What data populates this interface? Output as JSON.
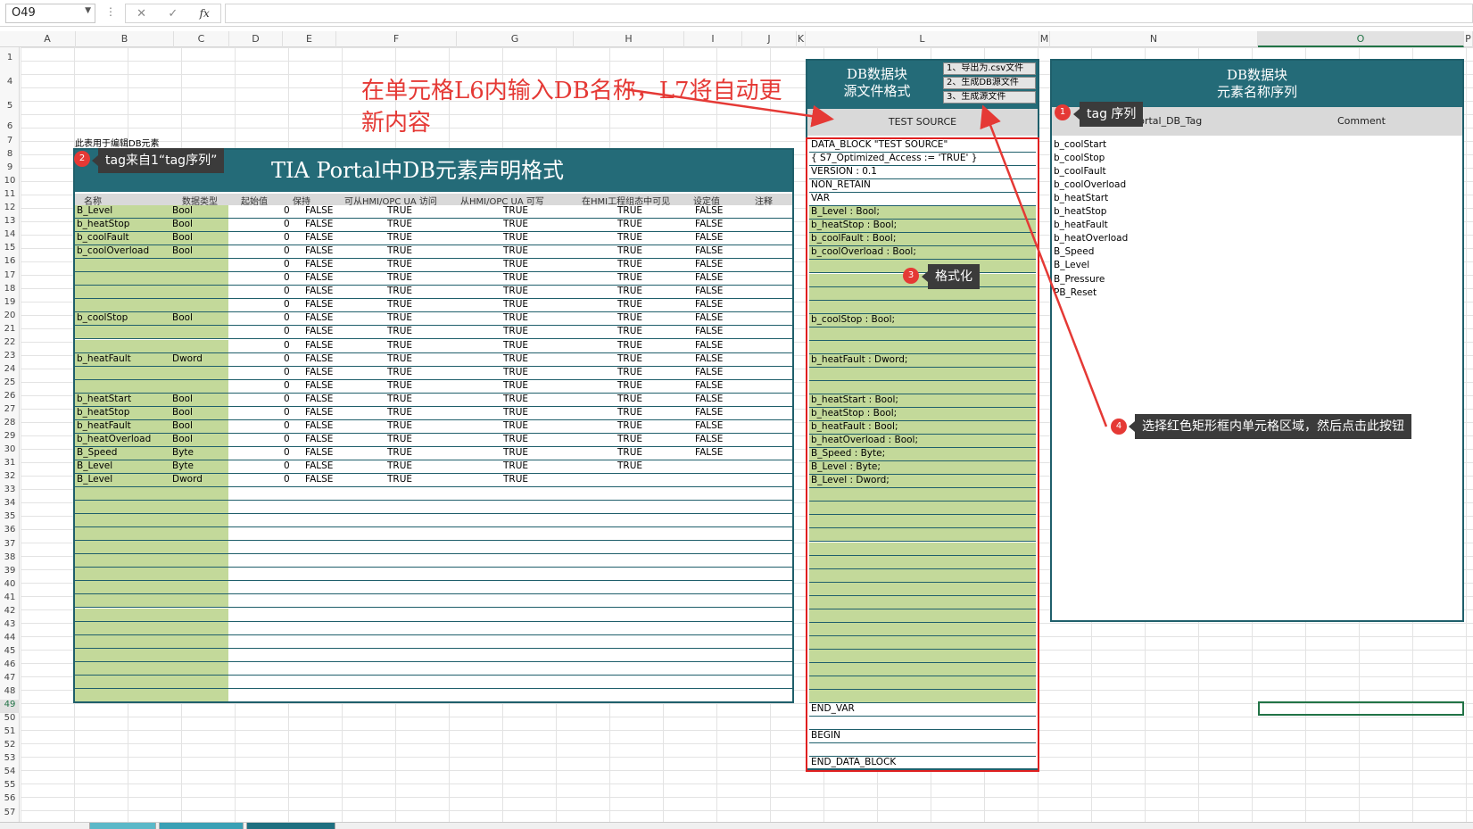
{
  "name_box": "O49",
  "formula_icons": {
    "cancel": "✕",
    "enter": "✓",
    "fx": "fx"
  },
  "columns": [
    "A",
    "B",
    "C",
    "D",
    "E",
    "F",
    "G",
    "H",
    "I",
    "J",
    "K",
    "L",
    "M",
    "N",
    "O",
    "P"
  ],
  "rows": [
    "1",
    "4",
    "5",
    "6",
    "7",
    "8",
    "9",
    "10",
    "11",
    "12",
    "13",
    "14",
    "15",
    "16",
    "17",
    "18",
    "19",
    "20",
    "21",
    "22",
    "23",
    "24",
    "25",
    "26",
    "27",
    "28",
    "29",
    "30",
    "31",
    "32",
    "33",
    "34",
    "35",
    "36",
    "37",
    "38",
    "39",
    "40",
    "41",
    "42",
    "43",
    "44",
    "45",
    "46",
    "47",
    "48",
    "49",
    "50",
    "51",
    "52",
    "53",
    "54",
    "55",
    "56",
    "57"
  ],
  "note_b7": "此表用于编辑DB元素",
  "left_table": {
    "title": "TIA Portal中DB元素声明格式",
    "headers": [
      "名称",
      "数据类型",
      "起始值",
      "保持",
      "可从HMI/OPC UA 访问",
      "从HMI/OPC UA 可写",
      "在HMI工程组态中可见",
      "设定值",
      "注释"
    ],
    "rows": [
      [
        "B_Level",
        "Bool",
        "0",
        "FALSE",
        "TRUE",
        "TRUE",
        "TRUE",
        "FALSE"
      ],
      [
        "b_heatStop",
        "Bool",
        "0",
        "FALSE",
        "TRUE",
        "TRUE",
        "TRUE",
        "FALSE"
      ],
      [
        "b_coolFault",
        "Bool",
        "0",
        "FALSE",
        "TRUE",
        "TRUE",
        "TRUE",
        "FALSE"
      ],
      [
        "b_coolOverload",
        "Bool",
        "0",
        "FALSE",
        "TRUE",
        "TRUE",
        "TRUE",
        "FALSE"
      ],
      [
        "",
        "",
        "0",
        "FALSE",
        "TRUE",
        "TRUE",
        "TRUE",
        "FALSE"
      ],
      [
        "",
        "",
        "0",
        "FALSE",
        "TRUE",
        "TRUE",
        "TRUE",
        "FALSE"
      ],
      [
        "",
        "",
        "0",
        "FALSE",
        "TRUE",
        "TRUE",
        "TRUE",
        "FALSE"
      ],
      [
        "",
        "",
        "0",
        "FALSE",
        "TRUE",
        "TRUE",
        "TRUE",
        "FALSE"
      ],
      [
        "b_coolStop",
        "Bool",
        "0",
        "FALSE",
        "TRUE",
        "TRUE",
        "TRUE",
        "FALSE"
      ],
      [
        "",
        "",
        "0",
        "FALSE",
        "TRUE",
        "TRUE",
        "TRUE",
        "FALSE"
      ],
      [
        "",
        "",
        "0",
        "FALSE",
        "TRUE",
        "TRUE",
        "TRUE",
        "FALSE"
      ],
      [
        "b_heatFault",
        "Dword",
        "0",
        "FALSE",
        "TRUE",
        "TRUE",
        "TRUE",
        "FALSE"
      ],
      [
        "",
        "",
        "0",
        "FALSE",
        "TRUE",
        "TRUE",
        "TRUE",
        "FALSE"
      ],
      [
        "",
        "",
        "0",
        "FALSE",
        "TRUE",
        "TRUE",
        "TRUE",
        "FALSE"
      ],
      [
        "b_heatStart",
        "Bool",
        "0",
        "FALSE",
        "TRUE",
        "TRUE",
        "TRUE",
        "FALSE"
      ],
      [
        "b_heatStop",
        "Bool",
        "0",
        "FALSE",
        "TRUE",
        "TRUE",
        "TRUE",
        "FALSE"
      ],
      [
        "b_heatFault",
        "Bool",
        "0",
        "FALSE",
        "TRUE",
        "TRUE",
        "TRUE",
        "FALSE"
      ],
      [
        "b_heatOverload",
        "Bool",
        "0",
        "FALSE",
        "TRUE",
        "TRUE",
        "TRUE",
        "FALSE"
      ],
      [
        "B_Speed",
        "Byte",
        "0",
        "FALSE",
        "TRUE",
        "TRUE",
        "TRUE",
        "FALSE"
      ],
      [
        "B_Level",
        "Byte",
        "0",
        "FALSE",
        "TRUE",
        "TRUE",
        "TRUE",
        ""
      ],
      [
        "B_Level",
        "Dword",
        "0",
        "FALSE",
        "TRUE",
        "TRUE",
        "",
        ""
      ]
    ],
    "empty_rows": 16
  },
  "source_table": {
    "title_line1": "DB数据块",
    "title_line2": "源文件格式",
    "buttons": [
      "1、导出为.csv文件",
      "2、生成DB源文件",
      "3、生成源文件"
    ],
    "db_name": "TEST SOURCE",
    "header_rows": [
      "DATA_BLOCK \"TEST SOURCE\"",
      "{ S7_Optimized_Access := 'TRUE' }",
      "VERSION : 0.1",
      "NON_RETAIN",
      "   VAR"
    ],
    "decl_rows": [
      "B_Level : Bool;",
      "b_heatStop : Bool;",
      "b_coolFault : Bool;",
      "b_coolOverload : Bool;",
      "",
      "",
      "",
      "",
      "b_coolStop : Bool;",
      "",
      "",
      "b_heatFault : Dword;",
      "",
      "",
      "b_heatStart : Bool;",
      "b_heatStop : Bool;",
      "b_heatFault : Bool;",
      "b_heatOverload : Bool;",
      "B_Speed : Byte;",
      "B_Level : Byte;",
      "B_Level : Dword;",
      "",
      "",
      "",
      "",
      "",
      "",
      "",
      "",
      "",
      "",
      "",
      "",
      "",
      "",
      "",
      ""
    ],
    "footer_rows": [
      "   END_VAR",
      "",
      "BEGIN",
      "",
      "END_DATA_BLOCK"
    ]
  },
  "name_table": {
    "title_line1": "DB数据块",
    "title_line2": "元素名称序列",
    "col1": "TIA_Portal_DB_Tag",
    "col2": "Comment",
    "tags": [
      "b_coolStart",
      "b_coolStop",
      "b_coolFault",
      "b_coolOverload",
      "b_heatStart",
      "b_heatStop",
      "b_heatFault",
      "b_heatOverload",
      "B_Speed",
      "B_Level",
      "B_Pressure",
      "PB_Reset"
    ]
  },
  "callouts": {
    "c1": {
      "num": "1",
      "text": "tag 序列"
    },
    "c2": {
      "num": "2",
      "text": "tag来自1“tag序列”"
    },
    "c3": {
      "num": "3",
      "text": "格式化"
    },
    "c4": {
      "num": "4",
      "text": "选择红色矩形框内单元格区域，然后点击此按钮"
    }
  },
  "annotation": "在单元格L6内输入DB名称，L7将自动更新内容",
  "accent_colors": {
    "header": "#246b78",
    "green": "#c3d99a",
    "red": "#e02020"
  }
}
